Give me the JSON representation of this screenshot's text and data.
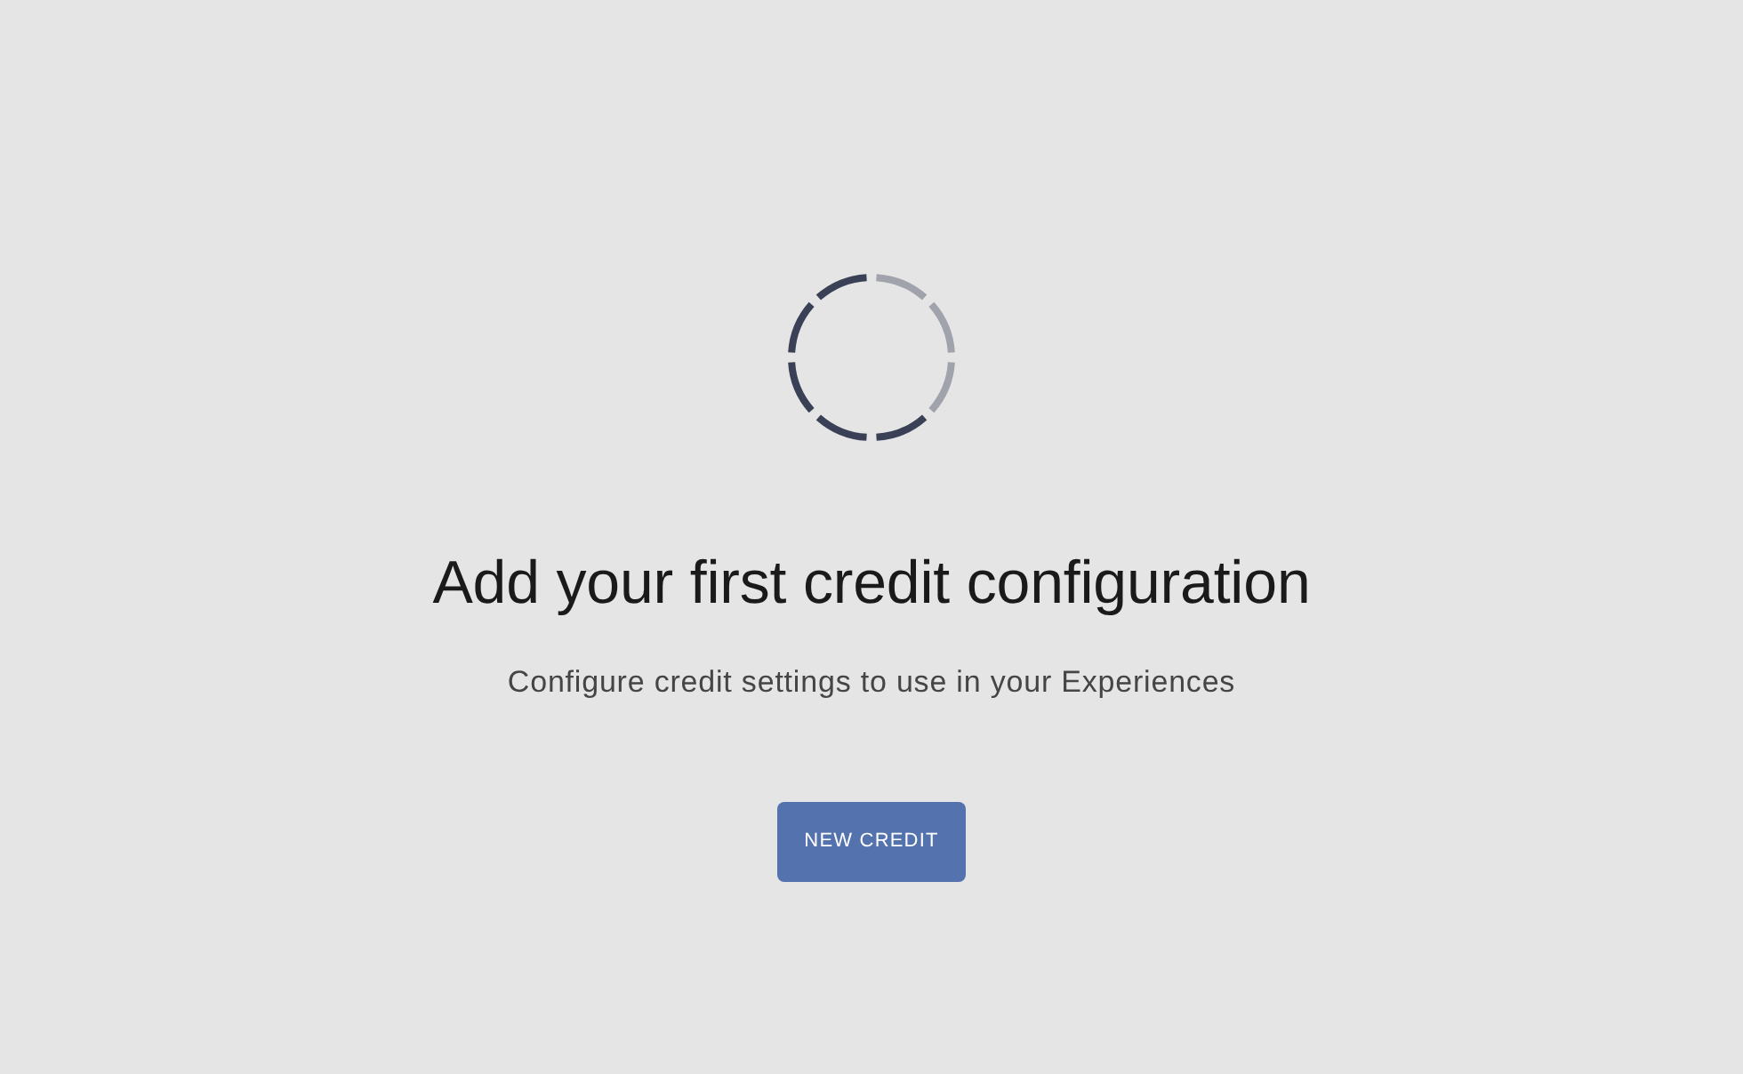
{
  "empty_state": {
    "heading": "Add your first credit configuration",
    "subtitle": "Configure credit settings to use in your Experiences",
    "button": {
      "label": "NEW CREDIT"
    }
  }
}
